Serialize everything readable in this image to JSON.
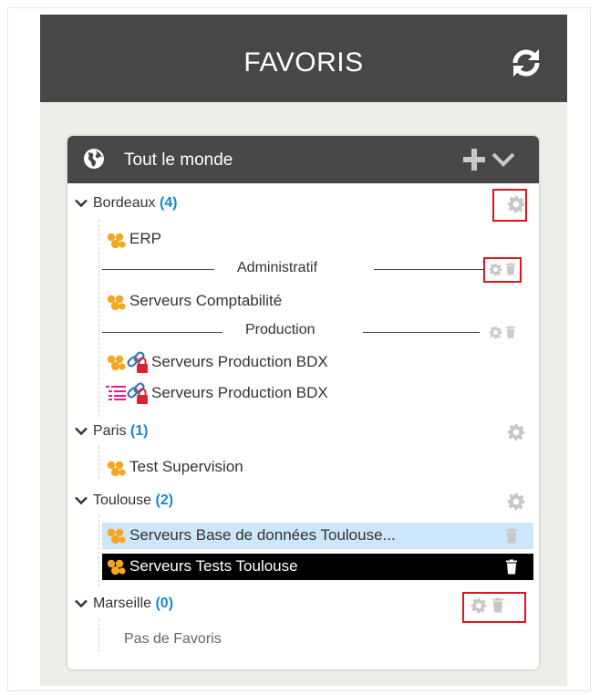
{
  "header": {
    "title": "FAVORIS",
    "refresh_icon": "refresh-icon"
  },
  "card": {
    "title": "Tout le monde",
    "globe_icon": "globe-icon",
    "add_icon": "plus-icon",
    "menu_icon": "chevron-down-icon"
  },
  "groups": [
    {
      "name": "Bordeaux",
      "count": "(4)"
    },
    {
      "name": "Paris",
      "count": "(1)"
    },
    {
      "name": "Toulouse",
      "count": "(2)"
    },
    {
      "name": "Marseille",
      "count": "(0)"
    }
  ],
  "separators": [
    {
      "label": "Administratif"
    },
    {
      "label": "Production"
    }
  ],
  "items": [
    {
      "label": "ERP"
    },
    {
      "label": "Serveurs Comptabilité"
    },
    {
      "label": "Serveurs Production BDX"
    },
    {
      "label": "Serveurs Production BDX"
    },
    {
      "label": "Test Supervision"
    },
    {
      "label": "Serveurs Base de données Toulouse..."
    },
    {
      "label": "Serveurs Tests Toulouse"
    }
  ],
  "empty_text": "Pas de Favoris",
  "colors": {
    "header_bg": "#474747",
    "panel_bg": "#efede8",
    "count_blue": "#1787d4",
    "hover_row": "#cce7fb",
    "selected_row": "#000000",
    "highlight_red": "#e0141e",
    "group_icon_orange": "#f5a623",
    "list_icon_magenta": "#e0218a",
    "link_icon_blue": "#3b6fb6",
    "lock_red": "#d9232e"
  }
}
